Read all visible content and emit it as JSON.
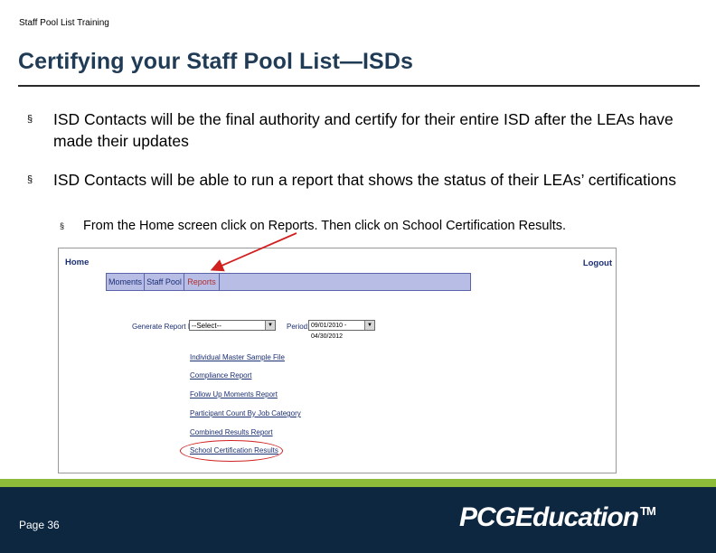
{
  "header": {
    "running_title": "Staff Pool List Training"
  },
  "slide": {
    "title": "Certifying your Staff Pool List—ISDs",
    "bullet_mark": "§",
    "bullets": [
      {
        "text": "ISD Contacts will be the final authority and certify for their entire ISD after the LEAs have made their updates"
      },
      {
        "text": "ISD Contacts will be able to run a report that shows the status of their LEAs’ certifications"
      }
    ],
    "sub_bullet": {
      "text": "From the Home screen click on Reports.  Then click on School Certification Results."
    }
  },
  "screenshot": {
    "home_link": "Home",
    "logout_link": "Logout",
    "tabs": [
      "Moments",
      "Staff Pool",
      "Reports"
    ],
    "generate_label": "Generate Report For:",
    "select_value": "--Select--",
    "period_label": "Period:",
    "period_value": "09/01/2010 - 04/30/2012",
    "dropdown_arrow": "▼",
    "reports": [
      "Individual Master Sample File",
      "Compliance Report",
      "Follow Up Moments Report",
      "Participant Count By Job Category",
      "Combined Results Report",
      "School Certification Results"
    ]
  },
  "footer": {
    "page_label": "Page 36",
    "logo_pcg": "PCG",
    "logo_edu": "Education",
    "logo_tm": "TM"
  },
  "colors": {
    "title": "#1f3b55",
    "footer_bg": "#0e2740",
    "footer_accent": "#8cbc3a",
    "annotation_red": "#d02020",
    "tab_bar": "#b8bde6"
  }
}
